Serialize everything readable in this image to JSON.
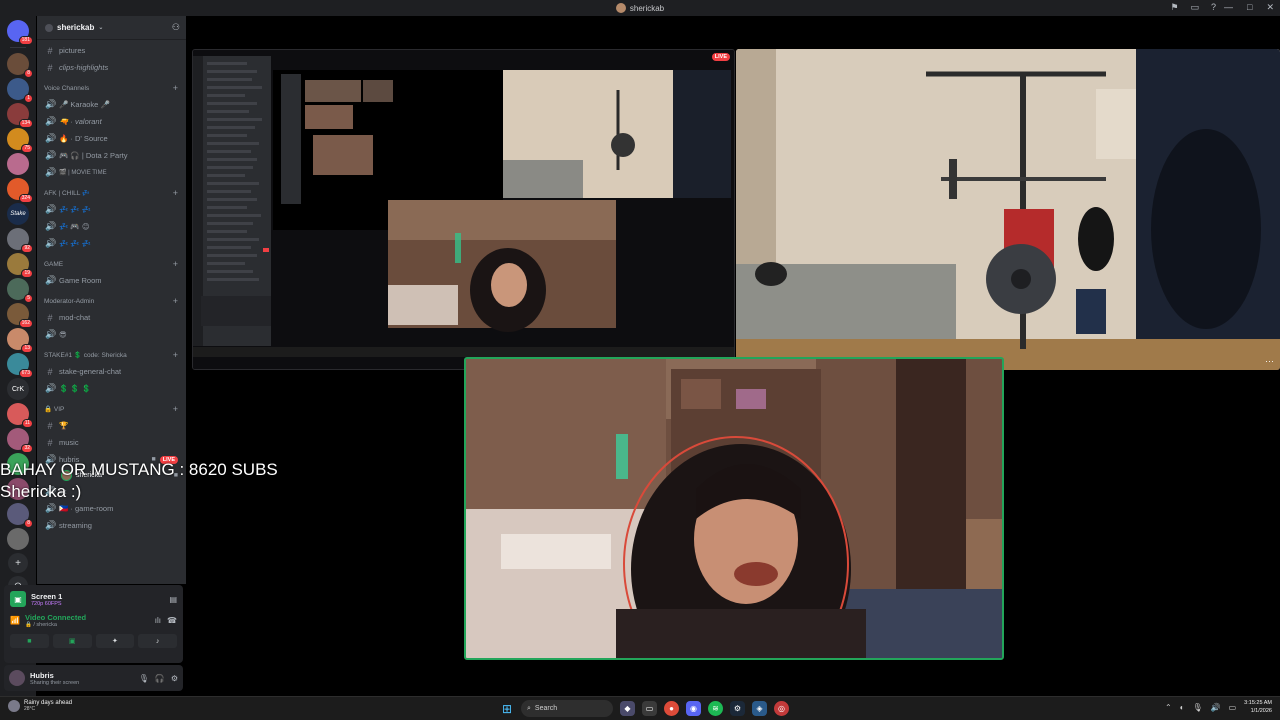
{
  "window": {
    "title": "sherickab",
    "controls": [
      "—",
      "□",
      "✕"
    ]
  },
  "guilds": {
    "badges": [
      "181",
      "8",
      "1",
      "134",
      "75",
      "324",
      "37",
      "92",
      "19",
      "5",
      "162",
      "13",
      "673",
      "11",
      "32",
      "8"
    ],
    "stake_label": "Stake",
    "crk_label": "CrK",
    "add_label": "+",
    "explore_label": "⊙"
  },
  "sidebar": {
    "server_name": "sherickab",
    "channels_top": [
      {
        "sym": "#",
        "label": "pictures",
        "italic": false
      },
      {
        "sym": "#",
        "label": "clips-highlights",
        "italic": true
      }
    ],
    "cat_voice": "Voice Channels",
    "voice_channels": [
      {
        "sym": "🔊",
        "label": "🎤 Karaoke 🎤",
        "italic": false
      },
      {
        "sym": "🔊",
        "label": "🔫 · valorant",
        "italic": true
      },
      {
        "sym": "🔊",
        "label": "🔥 · D' Source",
        "italic": false
      },
      {
        "sym": "🔊",
        "label": "🎮 🎧 | Dota 2 Party",
        "italic": false
      },
      {
        "sym": "🔊",
        "label": "🎬 | MOVIE TIME",
        "italic": false
      }
    ],
    "cat_afk": "AFK | CHILL 💤",
    "afk_channels": [
      {
        "sym": "🔊",
        "label": "💤 💤 💤"
      },
      {
        "sym": "🔊",
        "label": "💤 🎮 😊"
      },
      {
        "sym": "🔊",
        "label": "💤 💤 💤"
      }
    ],
    "cat_game": "GAME",
    "game_channels": [
      {
        "sym": "🔊",
        "label": "Game Room"
      }
    ],
    "cat_mod": "Moderator-Admin",
    "mod_channels": [
      {
        "sym": "#",
        "label": "mod-chat"
      },
      {
        "sym": "🔊",
        "label": "😎"
      }
    ],
    "cat_stake": "STAKE#1 💲 code: Shericka",
    "stake_channels": [
      {
        "sym": "#",
        "label": "stake-general-chat"
      },
      {
        "sym": "🔊",
        "label": "💲 💲 💲"
      }
    ],
    "cat_vip": "🔒 VIP",
    "vip_channels": [
      {
        "sym": "#",
        "label": "🏆"
      },
      {
        "sym": "#",
        "label": "music"
      }
    ],
    "hubris_channel": "hubris",
    "live_label": "LIVE",
    "voice_user": "shericka",
    "bottom_channels": [
      {
        "sym": "🔊",
        "label": "xx"
      },
      {
        "sym": "🔊",
        "label": "🇵🇭 · game-room"
      },
      {
        "sym": "🔊",
        "label": "streaming"
      }
    ]
  },
  "overlay": {
    "line1": "BAHAY OR MUSTANG : 8620 SUBS",
    "line2": "Shericka :)"
  },
  "screen_panel": {
    "title": "Screen 1",
    "subtitle": "720p 60FPS"
  },
  "voice_panel": {
    "status": "Video Connected",
    "channel": "🔒 / shericka"
  },
  "user_panel": {
    "name": "Hubris",
    "status": "Sharing their screen"
  },
  "stage": {
    "mini_live": "LIVE",
    "more": "···"
  },
  "taskbar": {
    "weather_title": "Rainy days ahead",
    "weather_temp": "28°C",
    "search_placeholder": "Search",
    "time": "3:15:25 AM",
    "date": "1/1/2026"
  }
}
